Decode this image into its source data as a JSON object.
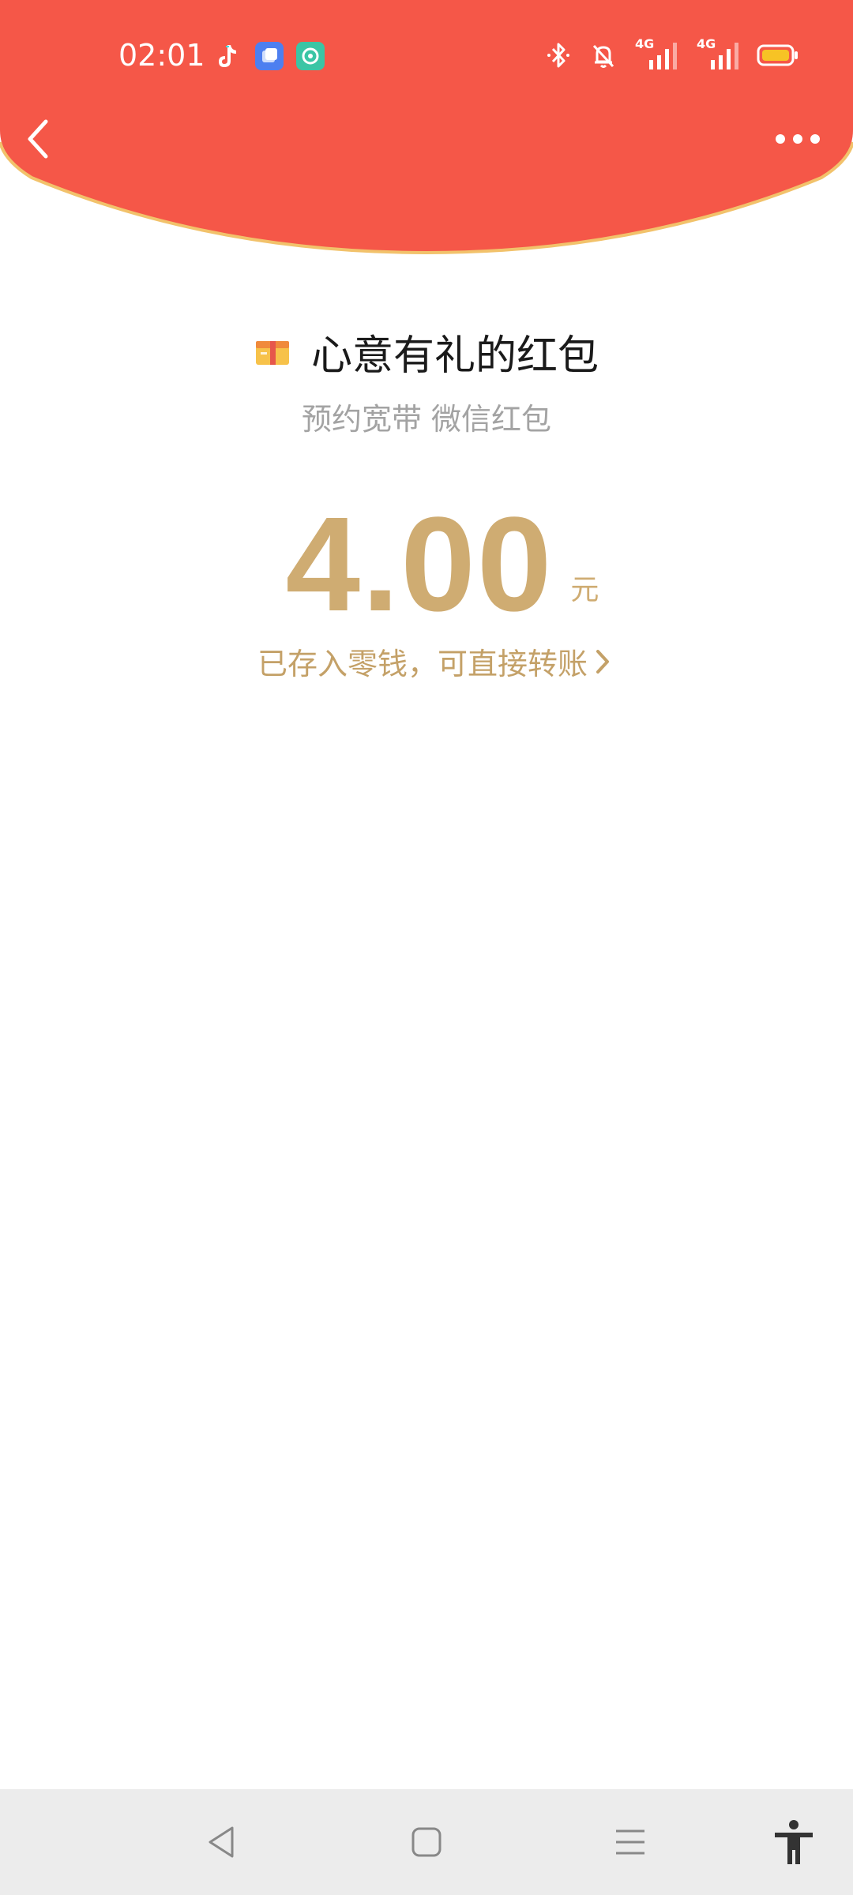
{
  "status_bar": {
    "time": "02:01",
    "app_icons": [
      "tiktok-icon",
      "blue-app-icon",
      "teal-app-icon"
    ],
    "right_icons": [
      "bluetooth-icon",
      "mute-bell-icon",
      "signal-4g-icon",
      "signal-4g-icon",
      "battery-icon"
    ],
    "network_label_1": "4G",
    "network_label_2": "4G"
  },
  "header": {
    "back_icon": "chevron-left-icon",
    "more_icon": "more-dots-icon"
  },
  "packet": {
    "sender_title": "心意有礼的红包",
    "subtitle": "预约宽带 微信红包",
    "amount": "4.00",
    "unit": "元",
    "saved_text": "已存入零钱，可直接转账"
  },
  "system_nav": {
    "buttons": [
      "back-triangle-icon",
      "home-square-icon",
      "menu-lines-icon",
      "accessibility-icon"
    ]
  },
  "colors": {
    "header_red": "#f55748",
    "header_border": "#f2c26b",
    "gold": "#cfac72",
    "subtitle_gray": "#a3a3a3",
    "nav_bg": "#ececec"
  }
}
